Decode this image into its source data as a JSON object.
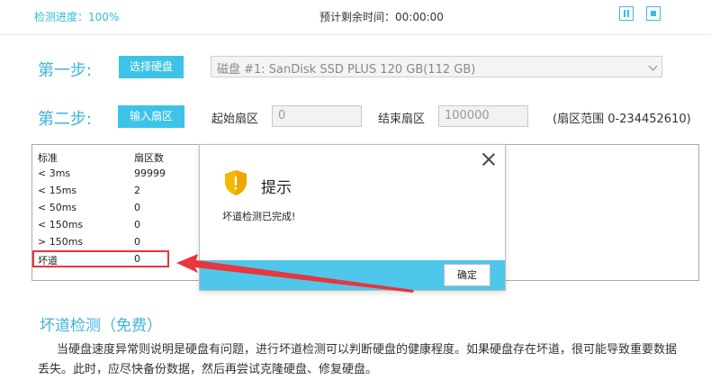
{
  "topbar": {
    "progress_text": "检测进度：100%",
    "remaining_text": "预计剩余时间：00:00:00",
    "pause_icon": "pause-icon",
    "stop_icon": "stop-icon"
  },
  "step1": {
    "label": "第一步:",
    "button": "选择硬盘",
    "disk_value": "磁盘 #1: SanDisk SSD PLUS 120 GB(112 GB)"
  },
  "step2": {
    "label": "第二步:",
    "button": "输入扇区",
    "start_label": "起始扇区",
    "start_value": "0",
    "end_label": "结束扇区",
    "end_value": "100000",
    "range_text": "(扇区范围 0-234452610)"
  },
  "table": {
    "headers": [
      "标准",
      "扇区数"
    ],
    "rows": [
      [
        "< 3ms",
        "99999"
      ],
      [
        "< 15ms",
        "2"
      ],
      [
        "< 50ms",
        "0"
      ],
      [
        "< 150ms",
        "0"
      ],
      [
        "> 150ms",
        "0"
      ],
      [
        "坏道",
        "0"
      ]
    ]
  },
  "dialog": {
    "title": "提示",
    "message": "坏道检测已完成!",
    "ok_label": "确定",
    "icon": "shield-warning-icon"
  },
  "section": {
    "title": "坏道检测（免费）",
    "paragraph": "当硬盘速度异常则说明是硬盘有问题，进行坏道检测可以判断硬盘的健康程度。如果硬盘存在坏道，很可能导致重要数据丢失。此时，应尽快备份数据，然后再尝试克隆硬盘、修复硬盘。"
  },
  "colors": {
    "accent": "#3ec3e8",
    "highlight": "#e8363c"
  }
}
